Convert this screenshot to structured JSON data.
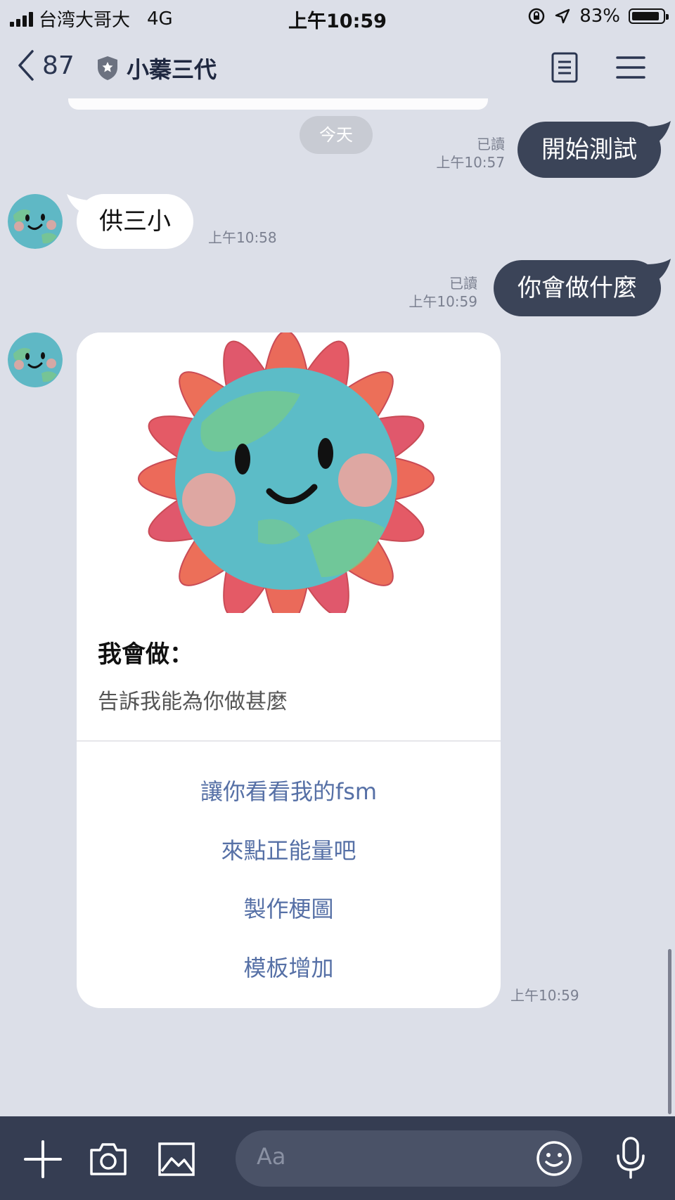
{
  "status_bar": {
    "carrier": "台湾大哥大",
    "network": "4G",
    "time": "上午10:59",
    "battery": "83%"
  },
  "header": {
    "back_count": "87",
    "chat_title": "小蓁三代"
  },
  "chat": {
    "date_divider": "今天",
    "messages": [
      {
        "direction": "out",
        "text": "開始測試",
        "read": "已讀",
        "time": "上午10:57"
      },
      {
        "direction": "in",
        "text": "供三小",
        "time": "上午10:58"
      },
      {
        "direction": "out",
        "text": "你會做什麼",
        "read": "已讀",
        "time": "上午10:59"
      }
    ],
    "card": {
      "title": "我會做：",
      "description": "告訴我能為你做甚麼",
      "actions": [
        "讓你看看我的fsm",
        "來點正能量吧",
        "製作梗圖",
        "模板增加"
      ],
      "time": "上午10:59"
    }
  },
  "input_bar": {
    "placeholder": "Aa"
  }
}
